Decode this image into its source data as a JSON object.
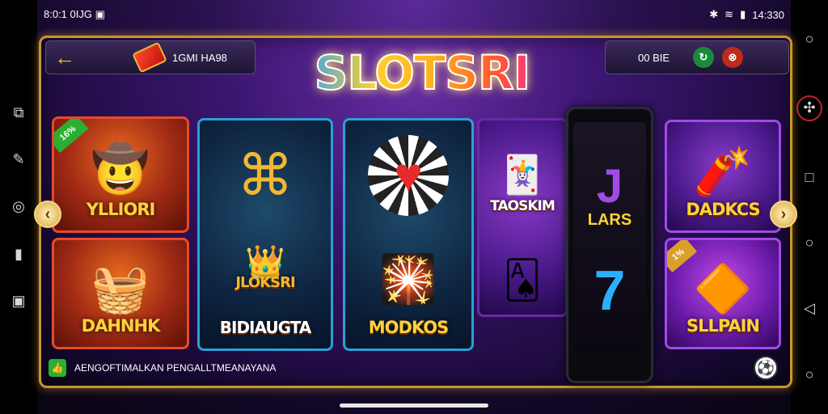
{
  "status": {
    "left_text": "8:0:1 0IJG ▣",
    "time": "14:330"
  },
  "topbar": {
    "back_icon": "arrow-left-icon",
    "label": "1GMI HA98"
  },
  "topright": {
    "label": "00 BIE",
    "btn1": "↻",
    "btn2": "⊗"
  },
  "logo": {
    "text": "SLOTSRI"
  },
  "cards": {
    "c1": {
      "title": "YLLIORI",
      "badge": "16%",
      "art": "🤠"
    },
    "c2": {
      "title": "",
      "art": "⌘"
    },
    "c3": {
      "title": "",
      "art": "♥"
    },
    "c4": {
      "title": "TAOSKIM",
      "art": "🃏"
    },
    "c5": {
      "title": "LARS",
      "art": "J"
    },
    "c6": {
      "title": "DADKCS",
      "art": "🧨"
    },
    "c7": {
      "title": "DAHNHK",
      "art": "🧺"
    },
    "c8": {
      "title": "BIDIAUGTA",
      "emblem": "JLOKSRI",
      "art": "👑"
    },
    "c9": {
      "title": "MODKOS",
      "art": "🎇"
    },
    "c10": {
      "title": "",
      "art": "🂡"
    },
    "c11": {
      "title": "",
      "art": "7"
    },
    "c12": {
      "title": "SLLPAIN",
      "badge": "1%",
      "art": "🔶"
    }
  },
  "ticker": {
    "text": "AENGOFTIMALKAN PENGALLTMEANAYANA"
  },
  "nav": {
    "prev": "‹",
    "next": "›"
  },
  "colors": {
    "gold": "#c9962a",
    "title_yellow": "#ffd23a"
  }
}
